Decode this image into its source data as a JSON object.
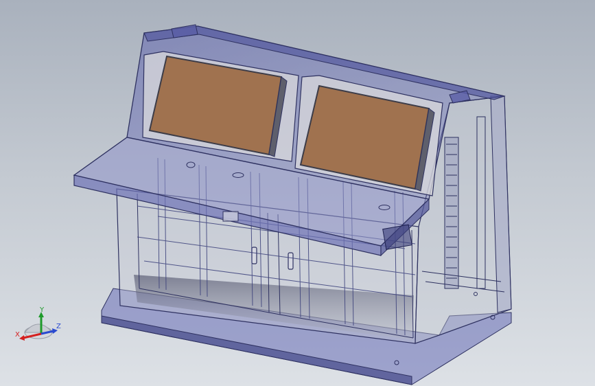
{
  "viewport": {
    "background_top": "#a9b1bd",
    "background_bottom": "#dde1e6"
  },
  "model": {
    "frame_color": "#3a3f7a",
    "glass_color": "#5b5fa8",
    "screen_color": "#a0724f",
    "screen_bezel": "#d9d9dc",
    "monitors": 2
  },
  "triad": {
    "x_label": "X",
    "y_label": "Y",
    "z_label": "Z",
    "x_color": "#d42020",
    "y_color": "#1e9a2a",
    "z_color": "#2a4ad0"
  }
}
